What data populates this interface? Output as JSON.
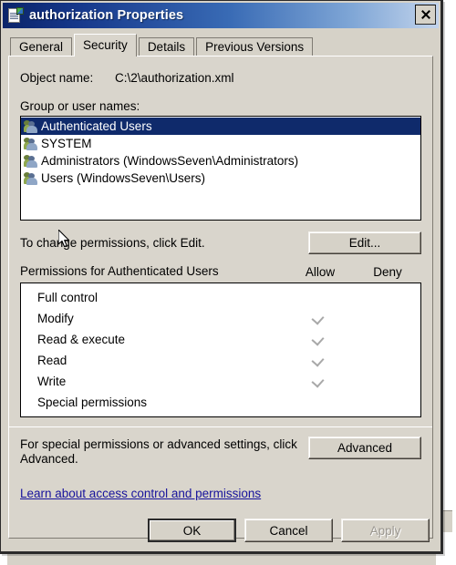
{
  "window": {
    "title": "authorization Properties",
    "icon": "xml-document-icon",
    "close_label": "Close"
  },
  "tabs": [
    {
      "label": "General",
      "active": false
    },
    {
      "label": "Security",
      "active": true
    },
    {
      "label": "Details",
      "active": false
    },
    {
      "label": "Previous Versions",
      "active": false
    }
  ],
  "security": {
    "object_name_label": "Object name:",
    "object_name_value": "C:\\2\\authorization.xml",
    "groups_label": "Group or user names:",
    "groups": [
      {
        "name": "Authenticated Users",
        "selected": true
      },
      {
        "name": "SYSTEM",
        "selected": false
      },
      {
        "name": "Administrators (WindowsSeven\\Administrators)",
        "selected": false
      },
      {
        "name": "Users (WindowsSeven\\Users)",
        "selected": false
      }
    ],
    "edit_hint": "To change permissions, click Edit.",
    "edit_button": "Edit...",
    "permissions_title": "Permissions for Authenticated Users",
    "allow_header": "Allow",
    "deny_header": "Deny",
    "permissions": [
      {
        "name": "Full control",
        "allow": false,
        "deny": false
      },
      {
        "name": "Modify",
        "allow": true,
        "deny": false
      },
      {
        "name": "Read & execute",
        "allow": true,
        "deny": false
      },
      {
        "name": "Read",
        "allow": true,
        "deny": false
      },
      {
        "name": "Write",
        "allow": true,
        "deny": false
      },
      {
        "name": "Special permissions",
        "allow": false,
        "deny": false
      }
    ],
    "advanced_hint": "For special permissions or advanced settings, click Advanced.",
    "advanced_button": "Advanced",
    "learn_link": "Learn about access control and permissions"
  },
  "footer": {
    "ok": "OK",
    "cancel": "Cancel",
    "apply": "Apply"
  },
  "colors": {
    "title_bar_start": "#0a246a",
    "title_bar_end": "#c3d4ec",
    "dialog_face": "#d6d2c8",
    "selection": "#0f2a6b",
    "link": "#17139c",
    "checkmark": "#a8a8a8"
  }
}
